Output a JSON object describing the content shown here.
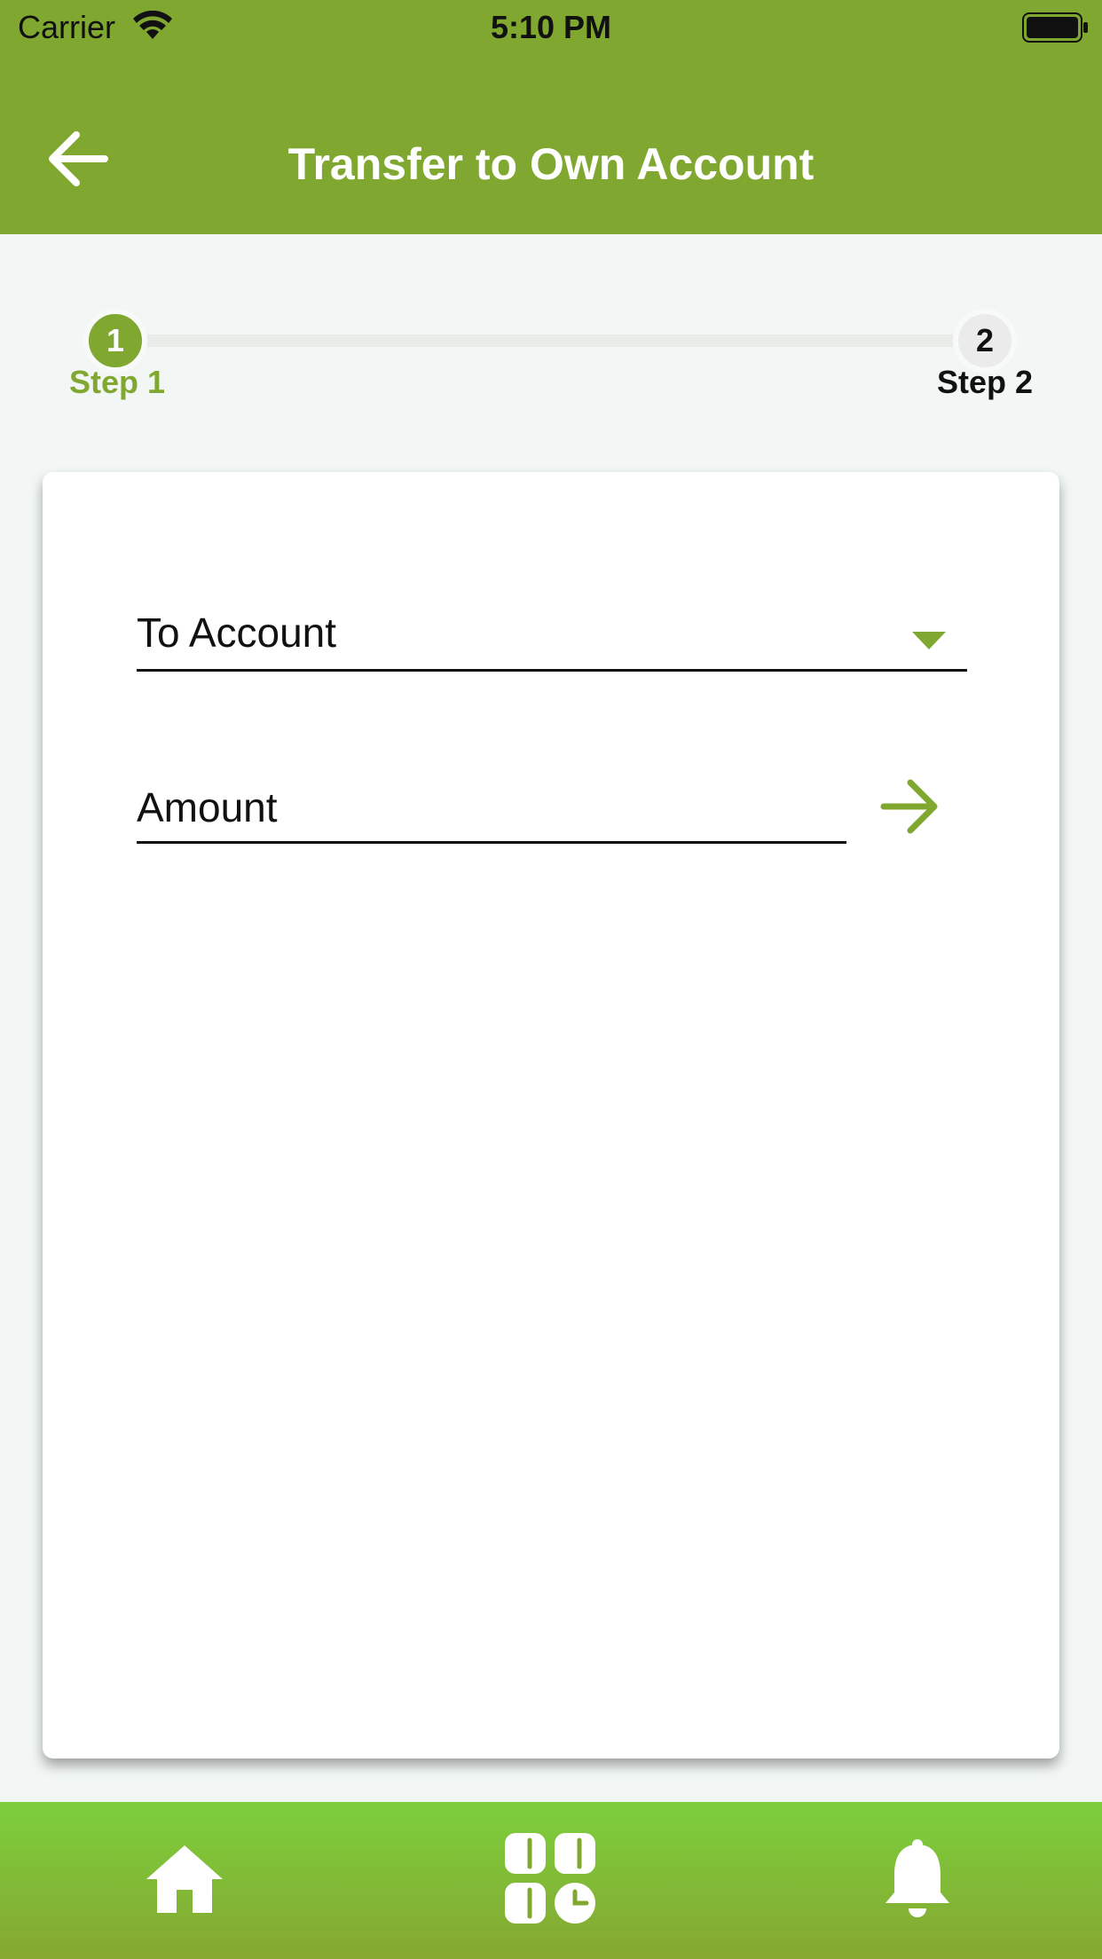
{
  "status_bar": {
    "carrier": "Carrier",
    "time": "5:10 PM"
  },
  "nav": {
    "title": "Transfer to Own Account",
    "back_icon": "arrow-left-icon"
  },
  "stepper": {
    "steps": [
      {
        "number": "1",
        "label": "Step 1",
        "state": "active"
      },
      {
        "number": "2",
        "label": "Step 2",
        "state": "inactive"
      }
    ]
  },
  "form": {
    "to_account": {
      "label": "To Account",
      "icon": "caret-down-icon"
    },
    "amount": {
      "placeholder": "Amount",
      "value": ""
    },
    "next_icon": "arrow-right-icon"
  },
  "tab_bar": {
    "tabs": [
      {
        "name": "home",
        "icon": "home-icon"
      },
      {
        "name": "apps",
        "icon": "grid-icon"
      },
      {
        "name": "notifications",
        "icon": "bell-icon"
      }
    ]
  },
  "colors": {
    "brand": "#80a830",
    "tab_bar_top": "#7ccf3c",
    "background": "#f2f7f5",
    "card": "#ffffff"
  }
}
